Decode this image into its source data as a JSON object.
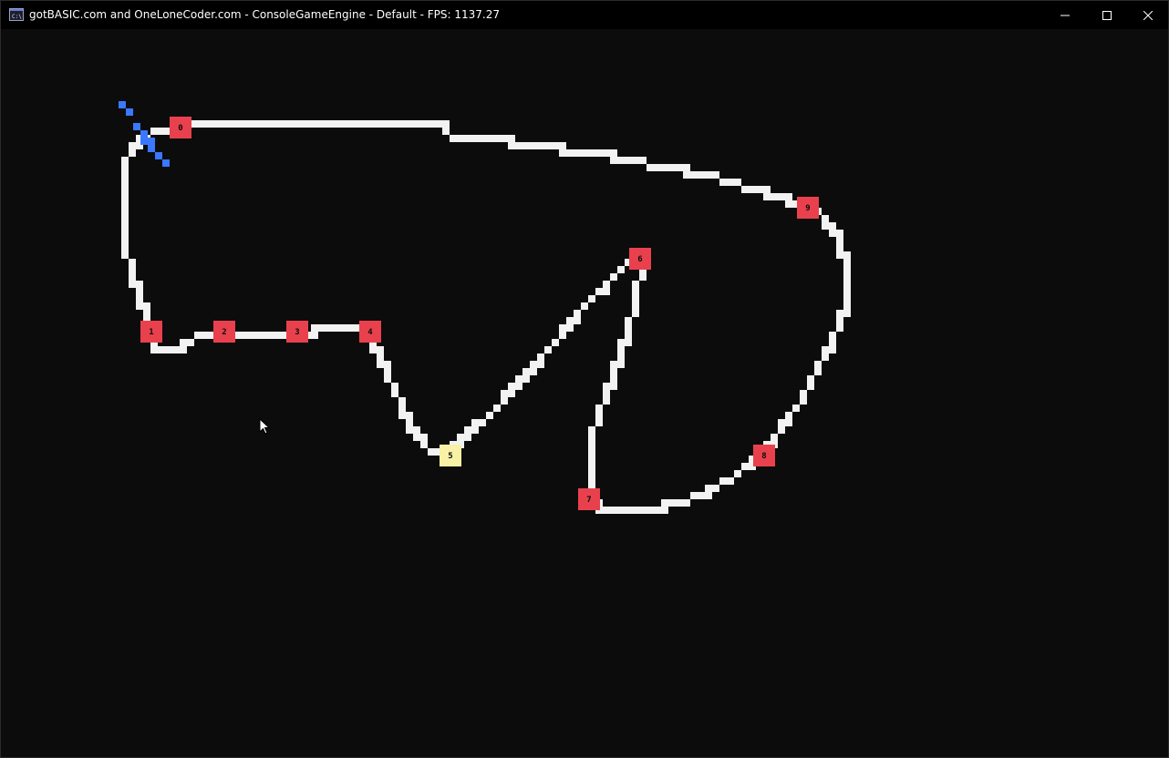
{
  "window": {
    "title": "gotBASIC.com and OneLoneCoder.com - ConsoleGameEngine - Default - FPS: 1137.27",
    "app_icon": "console-app-icon",
    "buttons": {
      "minimize": "minimize-icon",
      "maximize": "maximize-icon",
      "close": "close-icon"
    }
  },
  "game": {
    "colors": {
      "background": "#0c0c0c",
      "track": "#f2f2f2",
      "control_point": "#e8414d",
      "selected_point": "#f9f1a5",
      "agent": "#3a78ff",
      "label": "#0c0c0c"
    },
    "control_points": [
      {
        "label": "0"
      },
      {
        "label": "1"
      },
      {
        "label": "2"
      },
      {
        "label": "3"
      },
      {
        "label": "4"
      },
      {
        "label": "5",
        "selected": true
      },
      {
        "label": "6"
      },
      {
        "label": "7"
      },
      {
        "label": "8"
      },
      {
        "label": "9"
      }
    ],
    "agent_icon": "car-agent-icon",
    "cursor_icon": "mouse-cursor-icon"
  }
}
